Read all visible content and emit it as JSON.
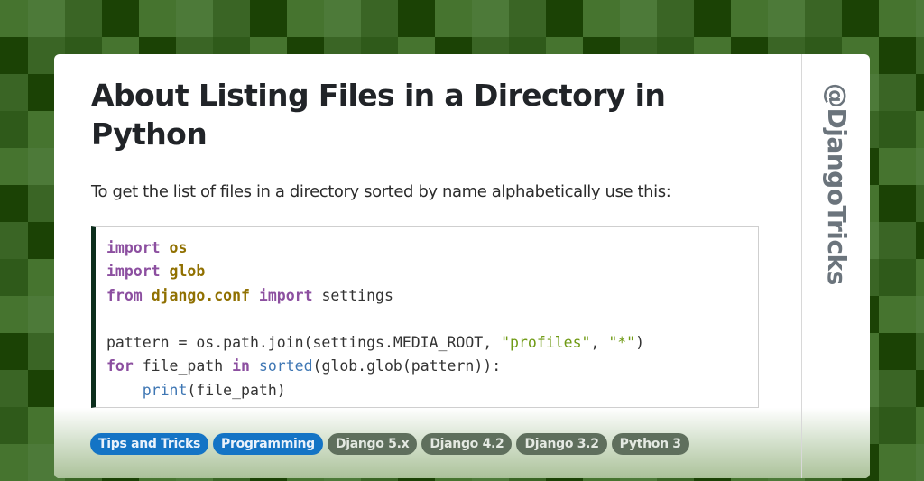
{
  "background": {
    "palette": [
      "#46742f",
      "#4d7a39",
      "#3a6525",
      "#1b4205",
      "#2f5a1a"
    ]
  },
  "post": {
    "title": "About Listing Files in a Directory in Python",
    "intro": "To get the list of files in a directory sorted by name alphabetically use this:",
    "code_lines": [
      [
        {
          "t": "import",
          "c": "kw"
        },
        {
          "t": " "
        },
        {
          "t": "os",
          "c": "mod"
        }
      ],
      [
        {
          "t": "import",
          "c": "kw"
        },
        {
          "t": " "
        },
        {
          "t": "glob",
          "c": "mod"
        }
      ],
      [
        {
          "t": "from",
          "c": "kw"
        },
        {
          "t": " "
        },
        {
          "t": "django.conf",
          "c": "mod"
        },
        {
          "t": " "
        },
        {
          "t": "import",
          "c": "kw"
        },
        {
          "t": " settings"
        }
      ],
      [
        {
          "t": ""
        }
      ],
      [
        {
          "t": "pattern = os.path.join(settings.MEDIA_ROOT, "
        },
        {
          "t": "\"profiles\"",
          "c": "str"
        },
        {
          "t": ", "
        },
        {
          "t": "\"*\"",
          "c": "str"
        },
        {
          "t": ")"
        }
      ],
      [
        {
          "t": "for",
          "c": "kw"
        },
        {
          "t": " file_path "
        },
        {
          "t": "in",
          "c": "kw"
        },
        {
          "t": " "
        },
        {
          "t": "sorted",
          "c": "bi"
        },
        {
          "t": "(glob.glob(pattern)):"
        }
      ],
      [
        {
          "t": "    "
        },
        {
          "t": "print",
          "c": "bi"
        },
        {
          "t": "(file_path)"
        }
      ]
    ]
  },
  "tags": [
    {
      "label": "Tips and Tricks",
      "style": "blue"
    },
    {
      "label": "Programming",
      "style": "blue"
    },
    {
      "label": "Django 5.x",
      "style": "gray"
    },
    {
      "label": "Django 4.2",
      "style": "gray"
    },
    {
      "label": "Django 3.2",
      "style": "gray"
    },
    {
      "label": "Python 3",
      "style": "gray"
    }
  ],
  "brand": {
    "handle": "@DjangoTricks"
  }
}
